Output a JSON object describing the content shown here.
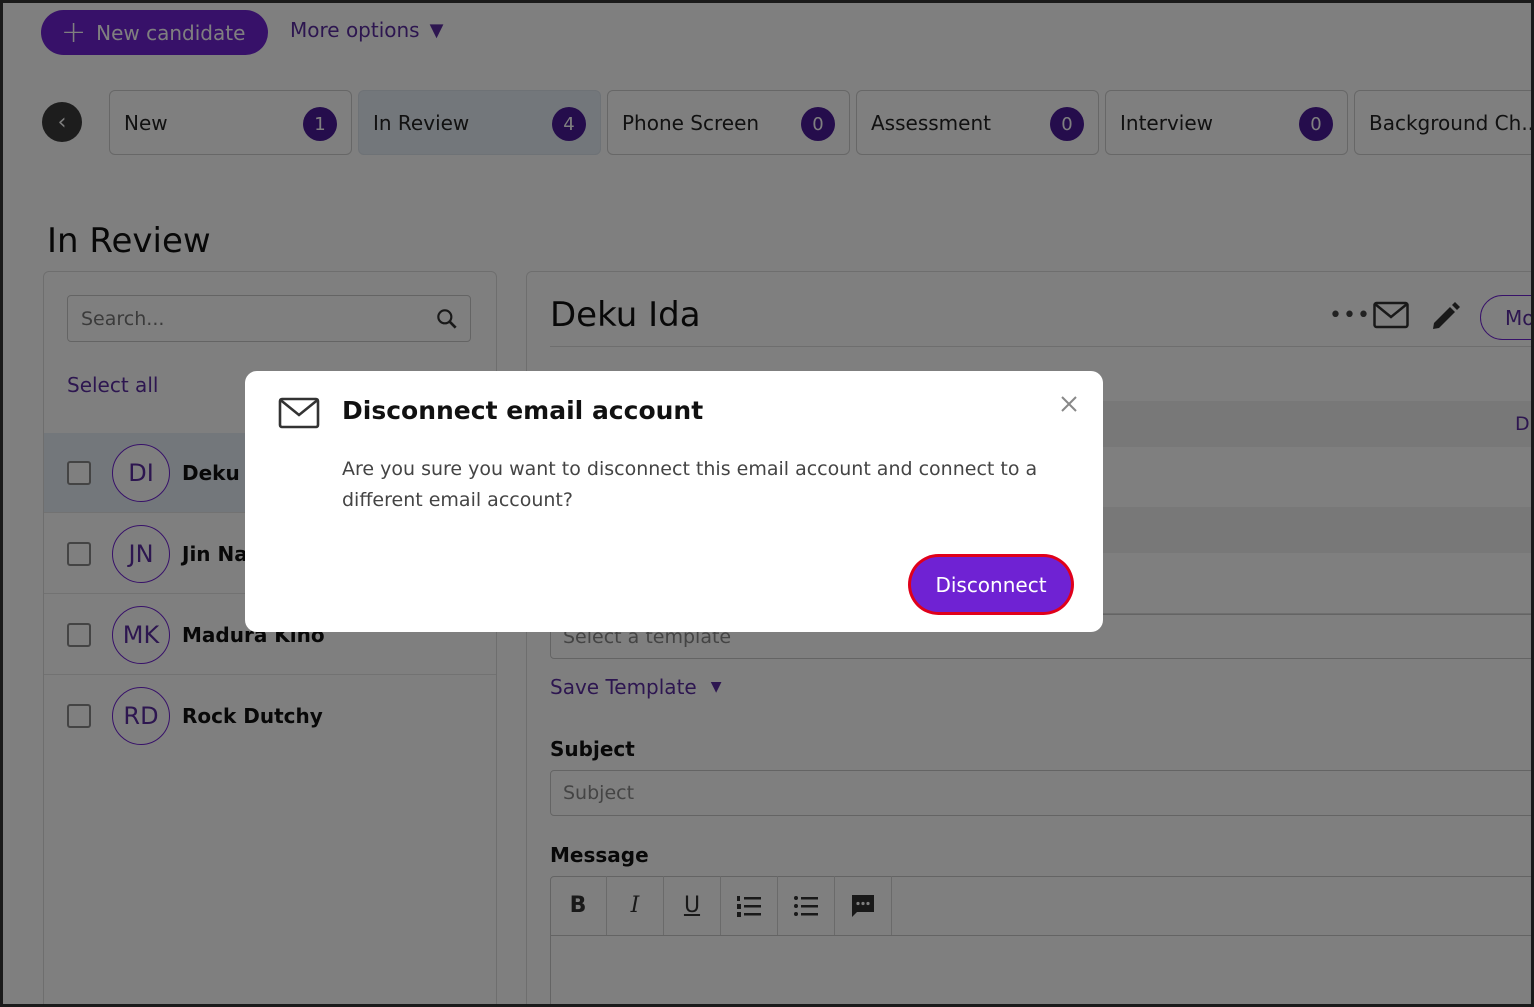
{
  "header": {
    "new_candidate_label": "New candidate",
    "more_options_label": "More options"
  },
  "stages": [
    {
      "label": "New",
      "count": "1"
    },
    {
      "label": "In Review",
      "count": "4"
    },
    {
      "label": "Phone Screen",
      "count": "0"
    },
    {
      "label": "Assessment",
      "count": "0"
    },
    {
      "label": "Interview",
      "count": "0"
    },
    {
      "label": "Background Ch..."
    }
  ],
  "section_title": "In Review",
  "left_panel": {
    "search_placeholder": "Search...",
    "select_all_label": "Select all",
    "candidates": [
      {
        "initials": "DI",
        "name": "Deku Ida"
      },
      {
        "initials": "JN",
        "name": "Jin Nat"
      },
      {
        "initials": "MK",
        "name": "Madura Kino"
      },
      {
        "initials": "RD",
        "name": "Rock Dutchy"
      }
    ]
  },
  "detail": {
    "candidate_name": "Deku Ida",
    "more_actions": "•••",
    "move_label": "Mo",
    "strip_text": "Di",
    "template_placeholder": "Select a template",
    "save_template_label": "Save Template",
    "subject_label": "Subject",
    "subject_placeholder": "Subject",
    "message_label": "Message",
    "toolbar": [
      "B",
      "I",
      "U"
    ]
  },
  "modal": {
    "title": "Disconnect email account",
    "body": "Are you sure you want to disconnect this email account and connect to a different email account?",
    "confirm_label": "Disconnect"
  },
  "colors": {
    "accent": "#6f22d3",
    "badge": "#4a1a99",
    "highlight": "#e0001b"
  }
}
